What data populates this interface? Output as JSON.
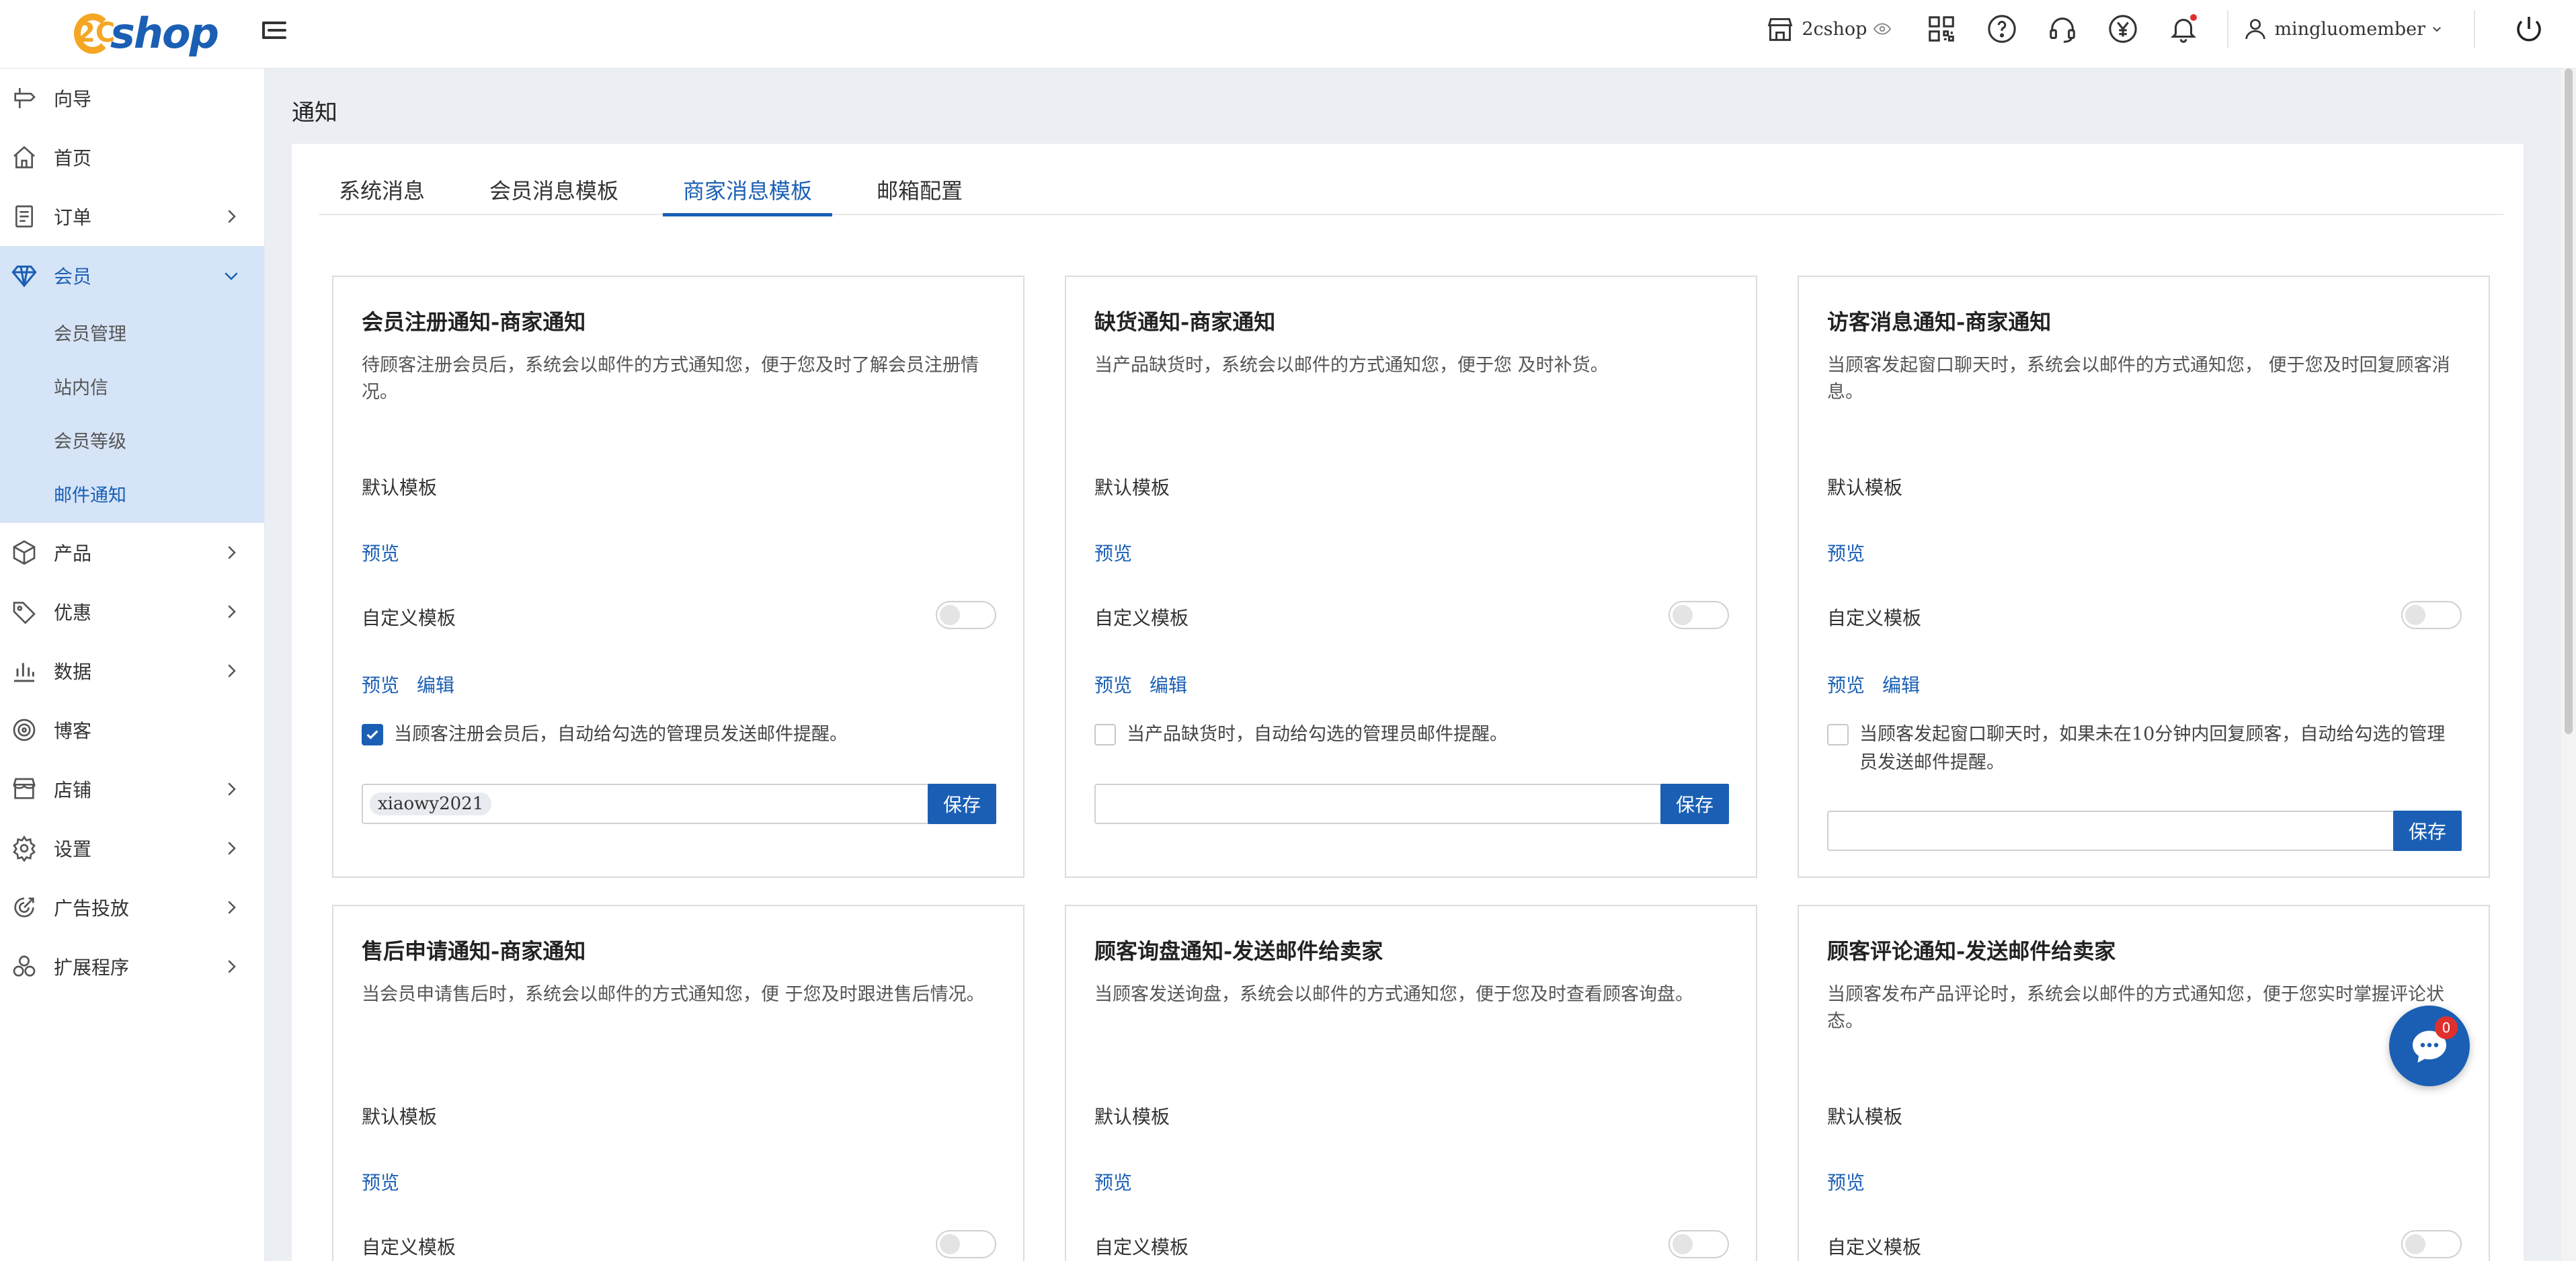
{
  "header": {
    "logo_num": "2C",
    "logo_text": "shop",
    "shop_name": "2cshop",
    "username": "mingluomember"
  },
  "sidebar": {
    "items": [
      {
        "label": "向导",
        "icon": "signpost-icon"
      },
      {
        "label": "首页",
        "icon": "home-icon"
      },
      {
        "label": "订单",
        "icon": "order-icon"
      },
      {
        "label": "会员",
        "icon": "diamond-icon"
      },
      {
        "label": "产品",
        "icon": "box-icon"
      },
      {
        "label": "优惠",
        "icon": "tag-icon"
      },
      {
        "label": "数据",
        "icon": "bar-chart-icon"
      },
      {
        "label": "博客",
        "icon": "target-icon"
      },
      {
        "label": "店铺",
        "icon": "store-icon"
      },
      {
        "label": "设置",
        "icon": "gear-icon"
      },
      {
        "label": "广告投放",
        "icon": "ad-icon"
      },
      {
        "label": "扩展程序",
        "icon": "extension-icon"
      }
    ],
    "member_sub": [
      "会员管理",
      "站内信",
      "会员等级",
      "邮件通知"
    ]
  },
  "page": {
    "title": "通知",
    "tabs": [
      "系统消息",
      "会员消息模板",
      "商家消息模板",
      "邮箱配置"
    ],
    "active_tab": 2
  },
  "labels": {
    "default_template": "默认模板",
    "custom_template": "自定义模板",
    "preview": "预览",
    "edit": "编辑",
    "save": "保存"
  },
  "cards": [
    {
      "title": "会员注册通知-商家通知",
      "desc": "待顾客注册会员后，系统会以邮件的方式通知您，便于您及时了解会员注册情况。",
      "check_text": "当顾客注册会员后，自动给勾选的管理员发送邮件提醒。",
      "checked": true,
      "tag": "xiaowy2021"
    },
    {
      "title": "缺货通知-商家通知",
      "desc": "当产品缺货时，系统会以邮件的方式通知您，便于您 及时补货。",
      "check_text": "当产品缺货时，自动给勾选的管理员邮件提醒。",
      "checked": false,
      "tag": ""
    },
    {
      "title": "访客消息通知-商家通知",
      "desc": "当顾客发起窗口聊天时，系统会以邮件的方式通知您， 便于您及时回复顾客消息。",
      "check_text": "当顾客发起窗口聊天时，如果未在10分钟内回复顾客，自动给勾选的管理员发送邮件提醒。",
      "checked": false,
      "tag": ""
    },
    {
      "title": "售后申请通知-商家通知",
      "desc": "当会员申请售后时，系统会以邮件的方式通知您，便 于您及时跟进售后情况。"
    },
    {
      "title": "顾客询盘通知-发送邮件给卖家",
      "desc": "当顾客发送询盘，系统会以邮件的方式通知您，便于您及时查看顾客询盘。"
    },
    {
      "title": "顾客评论通知-发送邮件给卖家",
      "desc": "当顾客发布产品评论时，系统会以邮件的方式通知您，便于您实时掌握评论状态。"
    }
  ],
  "chat": {
    "badge": "0"
  }
}
